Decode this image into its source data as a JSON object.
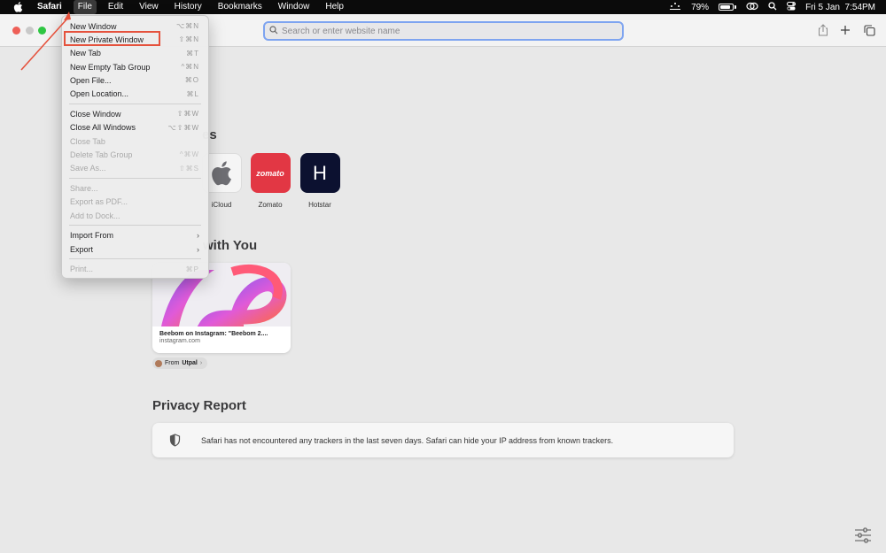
{
  "menubar": {
    "app_name": "Safari",
    "items": [
      "File",
      "Edit",
      "View",
      "History",
      "Bookmarks",
      "Window",
      "Help"
    ],
    "battery": "79%",
    "datetime": "Fri 5 Jan  7:54PM"
  },
  "toolbar": {
    "address_placeholder": "Search or enter website name"
  },
  "file_menu": {
    "groups": [
      [
        {
          "label": "New Window",
          "shortcut": "⌥⌘N",
          "enabled": true
        },
        {
          "label": "New Private Window",
          "shortcut": "⇧⌘N",
          "enabled": true
        },
        {
          "label": "New Tab",
          "shortcut": "⌘T",
          "enabled": true
        },
        {
          "label": "New Empty Tab Group",
          "shortcut": "^⌘N",
          "enabled": true
        },
        {
          "label": "Open File...",
          "shortcut": "⌘O",
          "enabled": true
        },
        {
          "label": "Open Location...",
          "shortcut": "⌘L",
          "enabled": true
        }
      ],
      [
        {
          "label": "Close Window",
          "shortcut": "⇧⌘W",
          "enabled": true
        },
        {
          "label": "Close All Windows",
          "shortcut": "⌥⇧⌘W",
          "enabled": true
        },
        {
          "label": "Close Tab",
          "shortcut": "",
          "enabled": false
        },
        {
          "label": "Delete Tab Group",
          "shortcut": "^⌘W",
          "enabled": false
        },
        {
          "label": "Save As...",
          "shortcut": "⇧⌘S",
          "enabled": false
        }
      ],
      [
        {
          "label": "Share...",
          "shortcut": "",
          "enabled": false
        },
        {
          "label": "Export as PDF...",
          "shortcut": "",
          "enabled": false
        },
        {
          "label": "Add to Dock...",
          "shortcut": "",
          "enabled": false
        }
      ],
      [
        {
          "label": "Import From",
          "shortcut": "",
          "enabled": true,
          "submenu": true
        },
        {
          "label": "Export",
          "shortcut": "",
          "enabled": true,
          "submenu": true
        }
      ],
      [
        {
          "label": "Print...",
          "shortcut": "⌘P",
          "enabled": false
        }
      ]
    ]
  },
  "start_page": {
    "favourites_title_visible": "es",
    "favourites": [
      {
        "label": "iCloud",
        "tile_color": "#f5f5f5",
        "icon": "apple-logo"
      },
      {
        "label": "Zomato",
        "tile_color": "#e23744",
        "tile_text": "zomato"
      },
      {
        "label": "Hotstar",
        "tile_color": "#0c1130",
        "tile_text": "H"
      }
    ],
    "shared_title_visible": "with You",
    "shared_card": {
      "title": "Beebom on Instagram: \"Beebom 2....",
      "domain": "instagram.com",
      "from_prefix": "From",
      "from_name": "Utpal"
    },
    "privacy_title": "Privacy Report",
    "privacy_text": "Safari has not encountered any trackers in the last seven days. Safari can hide your IP address from known trackers."
  },
  "colors": {
    "highlight": "#e5523d",
    "address_focus": "#7ea4f0"
  }
}
